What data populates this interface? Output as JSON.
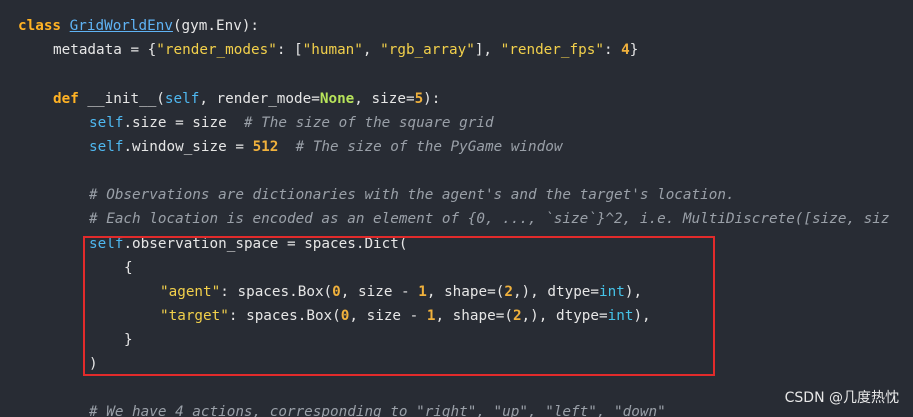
{
  "code": {
    "line1": {
      "kw_class": "class",
      "class_name": "GridWorldEnv",
      "rest": "(gym.Env):"
    },
    "line2": {
      "prefix": "metadata = {",
      "str1": "\"render_modes\"",
      "mid1": ": [",
      "str2": "\"human\"",
      "mid2": ", ",
      "str3": "\"rgb_array\"",
      "mid3": "], ",
      "str4": "\"render_fps\"",
      "mid4": ": ",
      "num": "4",
      "end": "}"
    },
    "line3": {
      "kw_def": "def",
      "fn": " __init__(",
      "self": "self",
      "mid": ", render_mode=",
      "none": "None",
      "mid2": ", size=",
      "num": "5",
      "end": "):"
    },
    "line4": {
      "self": "self",
      "code": ".size = size  ",
      "comment": "# The size of the square grid"
    },
    "line5": {
      "self": "self",
      "code": ".window_size = ",
      "num": "512",
      "space": "  ",
      "comment": "# The size of the PyGame window"
    },
    "line6": {
      "comment": "# Observations are dictionaries with the agent's and the target's location."
    },
    "line7": {
      "comment": "# Each location is encoded as an element of {0, ..., `size`}^2, i.e. MultiDiscrete([size, siz"
    },
    "line8": {
      "self": "self",
      "code": ".observation_space = spaces.Dict("
    },
    "line9": {
      "code": "{"
    },
    "line10": {
      "str": "\"agent\"",
      "code1": ": spaces.Box(",
      "num0": "0",
      "code2": ", size - ",
      "num1": "1",
      "code3": ", shape=(",
      "num2": "2",
      "code4": ",), dtype=",
      "builtin": "int",
      "end": "),"
    },
    "line11": {
      "str": "\"target\"",
      "code1": ": spaces.Box(",
      "num0": "0",
      "code2": ", size - ",
      "num1": "1",
      "code3": ", shape=(",
      "num2": "2",
      "code4": ",), dtype=",
      "builtin": "int",
      "end": "),"
    },
    "line12": {
      "code": "}"
    },
    "line13": {
      "code": ")"
    },
    "line14": {
      "comment": "# We have 4 actions, corresponding to \"right\", \"up\", \"left\", \"down\""
    }
  },
  "highlight_color": "#e22b2b",
  "watermark": "CSDN @几度热忱"
}
